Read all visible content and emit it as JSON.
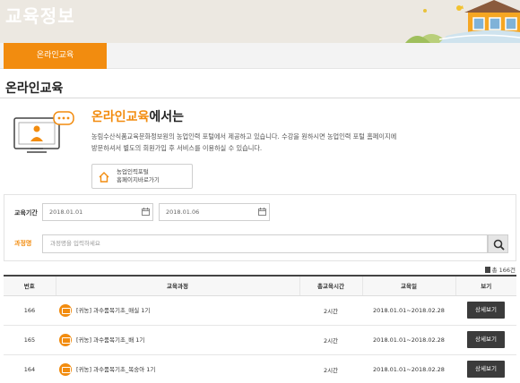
{
  "header": {
    "title": "교육정보"
  },
  "tabs": [
    {
      "label": "온라인교육",
      "active": true
    }
  ],
  "page": {
    "title": "온라인교육"
  },
  "intro": {
    "heading_highlight": "온라인교육",
    "heading_rest": "에서는",
    "desc_line1": "농림수산식품교육문화정보원의 농업인력 포털에서 제공하고 있습니다. 수강을 원하시면 농업인력 포털 홈페이지에",
    "desc_line2": "방문하셔서 별도의 회원가입 후 서비스를 이용하실 수 있습니다.",
    "portal_line1": "농업인력포털",
    "portal_line2": "홈페이지바로가기"
  },
  "search": {
    "period_label": "교육기간",
    "start_date": "2018.01.01",
    "end_date": "2018.01.06",
    "course_label": "과정명",
    "course_placeholder": "과정명을 입력하세요"
  },
  "count_text": "총 166건",
  "table": {
    "headers": [
      "번호",
      "교육과정",
      "총교육시간",
      "교육일",
      "보기"
    ],
    "rows": [
      {
        "no": "166",
        "title": "[귀농] 과수품목기초_매실 1기",
        "hours": "2시간",
        "dates": "2018.01.01~2018.02.28",
        "action": "상세보기"
      },
      {
        "no": "165",
        "title": "[귀농] 과수품목기초_배 1기",
        "hours": "2시간",
        "dates": "2018.01.01~2018.02.28",
        "action": "상세보기"
      },
      {
        "no": "164",
        "title": "[귀농] 과수품목기초_복숭아 1기",
        "hours": "2시간",
        "dates": "2018.01.01~2018.02.28",
        "action": "상세보기"
      }
    ]
  },
  "colors": {
    "accent": "#f28c0f",
    "banner_bg": "#ece8e1",
    "dark_button": "#3b3b3b"
  }
}
